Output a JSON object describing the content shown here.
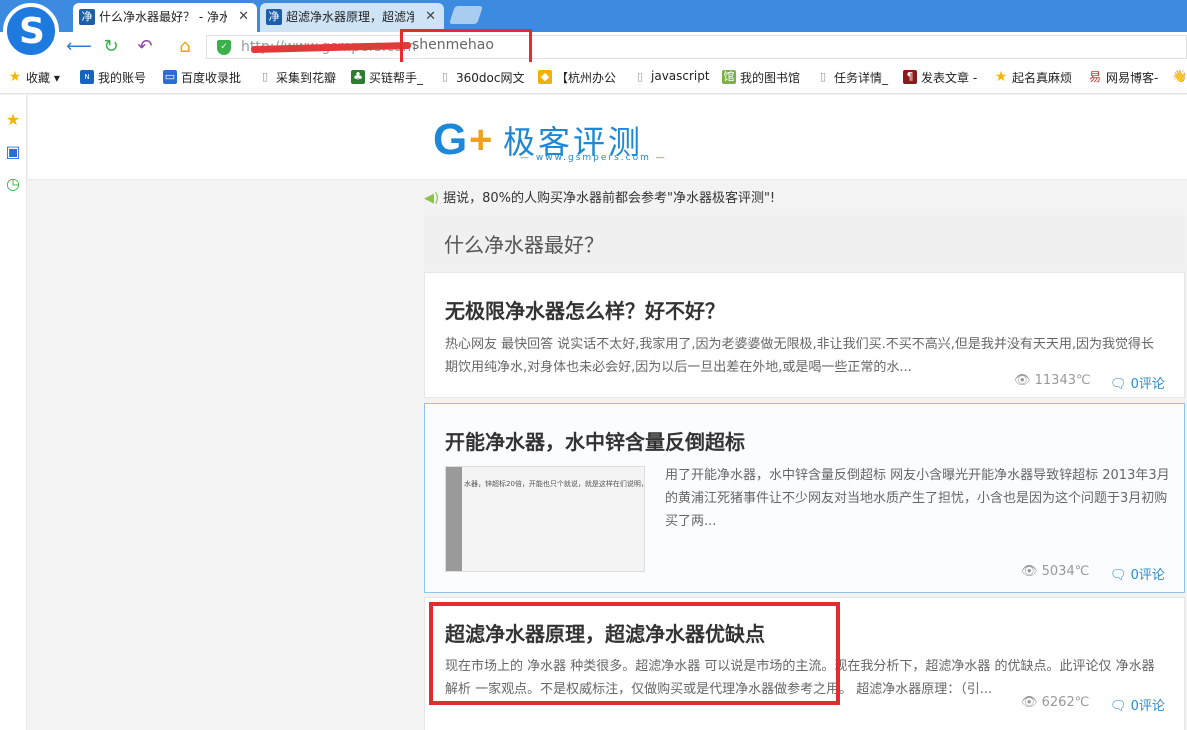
{
  "browser": {
    "tabs": [
      {
        "favicon": "净",
        "title": "什么净水器最好？ - 净水",
        "close": "✕"
      },
      {
        "favicon": "净",
        "title": "超滤净水器原理，超滤净",
        "close": "✕"
      }
    ],
    "address": {
      "prefix": "http://www.gsmpers.com",
      "highlighted_text": "shenmehao"
    },
    "bookmarks": [
      {
        "label": "收藏",
        "icon": "star-icon",
        "color": "#f4b400"
      },
      {
        "label": "我的账号",
        "icon": "news-icon",
        "color": "#1565c0"
      },
      {
        "label": "百度收录批",
        "icon": "monitor-icon",
        "color": "#2a6dd6"
      },
      {
        "label": "采集到花瓣",
        "icon": "page-icon",
        "color": "#9e9e9e"
      },
      {
        "label": "买链帮手_",
        "icon": "tree-icon",
        "color": "#2e7d32"
      },
      {
        "label": "360doc网文",
        "icon": "page-icon",
        "color": "#9e9e9e"
      },
      {
        "label": "【杭州办公",
        "icon": "app-icon",
        "color": "#f2b100"
      },
      {
        "label": "javascript",
        "icon": "page-icon",
        "color": "#9e9e9e"
      },
      {
        "label": "我的图书馆",
        "icon": "library-icon",
        "color": "#7cb342"
      },
      {
        "label": "任务详情_",
        "icon": "page-icon",
        "color": "#9e9e9e"
      },
      {
        "label": "发表文章 -",
        "icon": "post-icon",
        "color": "#8b1a1a"
      },
      {
        "label": "起名真麻烦",
        "icon": "star-icon",
        "color": "#f4b400"
      },
      {
        "label": "网易博客-",
        "icon": "netease-icon",
        "color": "#d32f2f"
      }
    ]
  },
  "site": {
    "brand_name": "极客评测",
    "brand_url": "— www.gsmpers.com —",
    "notice": "据说，80%的人购买净水器前都会参考\"净水器极客评测\"!",
    "category_title": "什么净水器最好？",
    "articles": [
      {
        "title": "无极限净水器怎么样？好不好？",
        "excerpt": "热心网友 最快回答 说实话不太好,我家用了,因为老婆婆做无限极,非让我们买.不买不高兴,但是我并没有天天用,因为我觉得长期饮用纯净水,对身体也未必会好,因为以后一旦出差在外地,或是喝一些正常的水...",
        "views": "11343℃",
        "comments": "0评论"
      },
      {
        "title": "开能净水器，水中锌含量反倒超标",
        "excerpt": "用了开能净水器，水中锌含量反倒超标 网友小含曝光开能净水器导致锌超标 2013年3月的黄浦江死猪事件让不少网友对当地水质产生了担忧，小含也是因为这个问题于3月初购买了两...",
        "views": "5034℃",
        "comments": "0评论",
        "thumb_text": "水器，锌超标20倍，开能也只个就说，就是这样在们说明，最底准们来说明"
      },
      {
        "title": "超滤净水器原理，超滤净水器优缺点",
        "excerpt": "现在市场上的 净水器 种类很多。超滤净水器 可以说是市场的主流。现在我分析下，超滤净水器 的优缺点。此评论仅 净水器解析 一家观点。不是权威标注，仅做购买或是代理净水器做参考之用。 超滤净水器原理：（引...",
        "views": "6262℃",
        "comments": "0评论"
      }
    ]
  },
  "colors": {
    "accent": "#1e88d8",
    "highlight": "#e52b2b",
    "link": "#2d8bd2"
  }
}
